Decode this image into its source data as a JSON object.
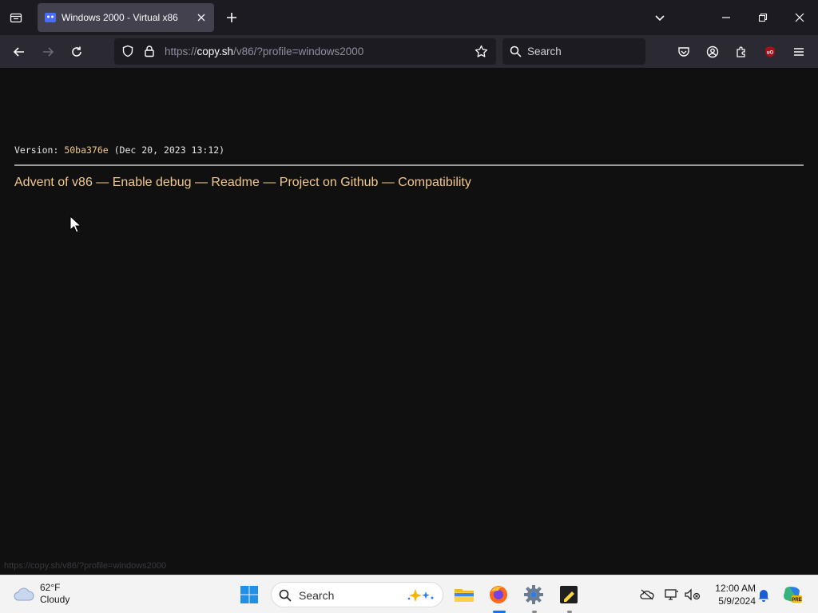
{
  "browser": {
    "tab": {
      "title": "Windows 2000 - Virtual x86"
    },
    "url": {
      "scheme": "https://",
      "host": "copy.sh",
      "path": "/v86/?profile=windows2000"
    },
    "search_placeholder": "Search"
  },
  "page": {
    "version_label": "Version: ",
    "version_hash": "50ba376e",
    "version_date": " (Dec 20, 2023 13:12)",
    "links": [
      "Advent of v86",
      "Enable debug",
      "Readme",
      "Project on Github",
      "Compatibility"
    ],
    "separator": " — ",
    "status_url": "https://copy.sh/v86/?profile=windows2000"
  },
  "taskbar": {
    "weather_temp": "62°F",
    "weather_desc": "Cloudy",
    "search_label": "Search",
    "time": "12:00 AM",
    "date": "5/9/2024"
  },
  "colors": {
    "link": "#f0c88a",
    "page_bg": "#101011",
    "taskbar_bg": "#f3f3f3"
  }
}
